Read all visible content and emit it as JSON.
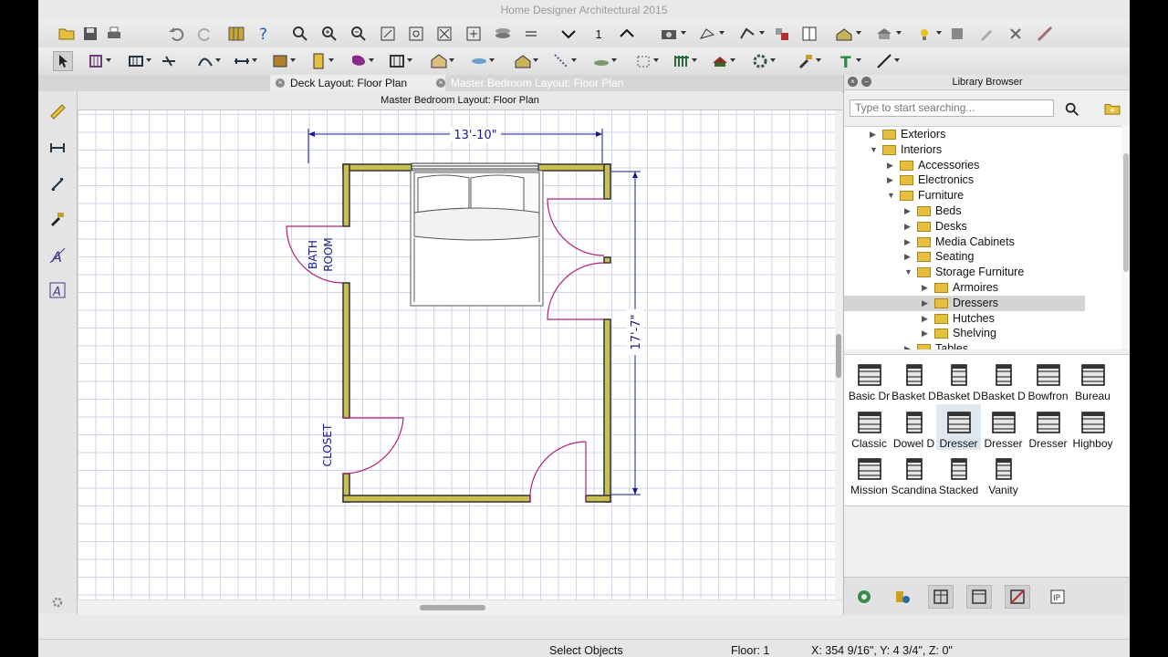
{
  "app_title": "Home Designer Architectural 2015",
  "toolbar1": {
    "tools": [
      "open-icon",
      "save-icon",
      "print-icon",
      "undo-icon",
      "redo-icon",
      "library-icon",
      "help-icon",
      "zoom-icon",
      "zoom-in-icon",
      "zoom-out-icon",
      "fill-window-icon",
      "zoom-extents-icon",
      "expand-icon",
      "add-icon",
      "layers-icon",
      "reference-icon",
      "down-floor-icon",
      "up-floor-icon",
      "camera-icon",
      "glass-view-icon",
      "sketch-view-icon",
      "material-icon",
      "window-tool-icon",
      "roof-tool-icon",
      "light-icon",
      "plant-icon",
      "pen-icon",
      "chain-icon",
      "ruler-icon"
    ],
    "floor_number": "1"
  },
  "toolbar2": {
    "tools": [
      "select-icon",
      "wall-icon",
      "railing-icon",
      "break-wall-icon",
      "dimension-icon",
      "cabinet-icon",
      "door-icon",
      "stairs-icon",
      "window-icon",
      "house-icon",
      "beam-icon",
      "room-icon",
      "terrain-icon",
      "path-icon",
      "fence-icon",
      "box-icon",
      "rail-icon",
      "roof-icon",
      "gear-icon",
      "hammer-icon",
      "text-icon",
      "line-icon"
    ]
  },
  "tabs": [
    {
      "label": "Deck Layout: Floor Plan",
      "active": true
    },
    {
      "label": "Master Bedroom Layout: Floor Plan",
      "active": false
    }
  ],
  "view_title": "Master Bedroom Layout: Floor Plan",
  "left_tools": [
    "tape-measure-icon",
    "dimension-icon",
    "angle-icon",
    "paint-icon",
    "text-style-icon",
    "edit-image-icon"
  ],
  "plan": {
    "width_dim": "13'-10\"",
    "height_dim": "17'-7\"",
    "label_bath": "BATH",
    "label_room": "ROOM",
    "label_closet": "CLOSET"
  },
  "library": {
    "title": "Library Browser",
    "search_placeholder": "Type to start searching...",
    "tree": [
      {
        "label": "Exteriors",
        "depth": 0,
        "expanded": false
      },
      {
        "label": "Interiors",
        "depth": 0,
        "expanded": true
      },
      {
        "label": "Accessories",
        "depth": 1,
        "expanded": false
      },
      {
        "label": "Electronics",
        "depth": 1,
        "expanded": false
      },
      {
        "label": "Furniture",
        "depth": 1,
        "expanded": true
      },
      {
        "label": "Beds",
        "depth": 2,
        "expanded": false
      },
      {
        "label": "Desks",
        "depth": 2,
        "expanded": false
      },
      {
        "label": "Media Cabinets",
        "depth": 2,
        "expanded": false
      },
      {
        "label": "Seating",
        "depth": 2,
        "expanded": false
      },
      {
        "label": "Storage Furniture",
        "depth": 2,
        "expanded": true
      },
      {
        "label": "Armoires",
        "depth": 3,
        "expanded": false
      },
      {
        "label": "Dressers",
        "depth": 3,
        "expanded": false,
        "selected": true
      },
      {
        "label": "Hutches",
        "depth": 3,
        "expanded": false
      },
      {
        "label": "Shelving",
        "depth": 3,
        "expanded": false
      },
      {
        "label": "Tables",
        "depth": 2,
        "expanded": false
      }
    ],
    "items": [
      {
        "label": "Basic Dr"
      },
      {
        "label": "Basket D"
      },
      {
        "label": "Basket D"
      },
      {
        "label": "Basket D"
      },
      {
        "label": "Bowfron"
      },
      {
        "label": "Bureau"
      },
      {
        "label": "Classic"
      },
      {
        "label": "Dowel D"
      },
      {
        "label": "Dresser",
        "selected": true
      },
      {
        "label": "Dresser"
      },
      {
        "label": "Dresser"
      },
      {
        "label": "Highboy"
      },
      {
        "label": "Mission"
      },
      {
        "label": "Scandina"
      },
      {
        "label": "Stacked"
      },
      {
        "label": "Vanity"
      }
    ],
    "bottom_icons": [
      "globe-icon",
      "library-object-icon",
      "plan-view-icon",
      "elevation-view-icon",
      "no-preview-icon",
      "info-icon"
    ]
  },
  "status": {
    "mode": "Select Objects",
    "floor": "Floor: 1",
    "coords": "X: 354 9/16\", Y: 4 3/4\", Z: 0\""
  },
  "colors": {
    "wall": "#c9c050",
    "dim": "#1a1a8c",
    "door": "#b0207a",
    "grid": "#cfd6e6"
  }
}
